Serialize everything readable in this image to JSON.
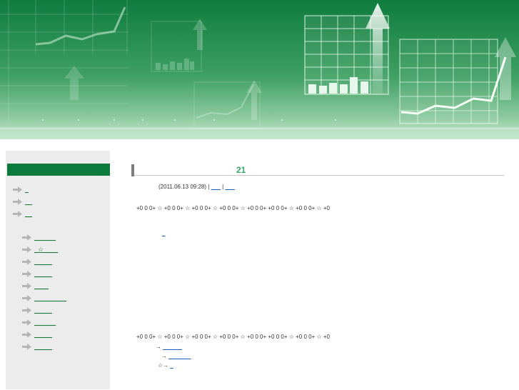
{
  "banner": {
    "bg_top": "#0e7a3c",
    "bg_bottom": "#9fd6ae",
    "accent": "#e8f7ec"
  },
  "sidebar": {
    "top_links": [
      {
        "label": "_",
        "underline_width": 8
      },
      {
        "label": "__",
        "underline_width": 12
      },
      {
        "label": "__",
        "underline_width": 14
      }
    ],
    "sub_links": [
      {
        "label": "______"
      },
      {
        "label": "_☆____"
      },
      {
        "label": "_____"
      },
      {
        "label": "_____"
      },
      {
        "label": "____"
      },
      {
        "label": "_________"
      },
      {
        "label": "_____"
      },
      {
        "label": "______"
      },
      {
        "label": "_____"
      },
      {
        "label": "_____"
      }
    ]
  },
  "post": {
    "title": "21",
    "date": "(2011.06.13 09:28)",
    "sep1": "|",
    "sep2": "|",
    "meta_link1": "___",
    "meta_link2": "___",
    "body_line1": "+0 0 0+ ☆ +0 0 0+ ☆ +0 0 0+ ☆ +0 0 0+ ☆ +0 0 0+ +0 0 0+ ☆ +0 0 0+ ☆ +0",
    "body_link": "_",
    "body_line2": "+0 0 0+ ☆ +0 0 0+ ☆ +0 0 0+ ☆ +0 0 0+ ☆ +0 0 0+ +0 0 0+ ☆ +0 0 0+ ☆ +0",
    "related": [
      {
        "prefix": "→",
        "label": "______"
      },
      {
        "prefix": "→",
        "label": "_______"
      },
      {
        "prefix": "☆→",
        "label": "_"
      }
    ]
  }
}
